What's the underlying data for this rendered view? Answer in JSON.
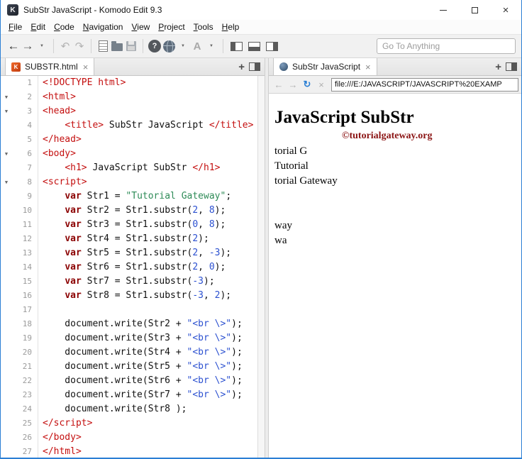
{
  "window": {
    "title": "SubStr JavaScript - Komodo Edit 9.3",
    "app_icon_letter": "K"
  },
  "menu": {
    "items": [
      "File",
      "Edit",
      "Code",
      "Navigation",
      "View",
      "Project",
      "Tools",
      "Help"
    ]
  },
  "toolbar": {
    "goto_placeholder": "Go To Anything",
    "font_button": "A"
  },
  "icons": {
    "back": "←",
    "forward": "→",
    "dropdown": "▼",
    "undo": "↶",
    "redo": "↷",
    "help": "?",
    "close": "×",
    "tab_close": "×",
    "plus": "+",
    "refresh": "↻",
    "stop": "×",
    "fold": "▼",
    "file_letter": "K"
  },
  "tabs": {
    "editor": {
      "label": "SUBSTR.html"
    },
    "preview": {
      "label": "SubStr JavaScript"
    }
  },
  "browser": {
    "url": "file:///E:/JAVASCRIPT/JAVASCRIPT%20EXAMP"
  },
  "code": {
    "lines": [
      {
        "n": 1,
        "t": [
          [
            "tag",
            "<!DOCTYPE html>"
          ]
        ]
      },
      {
        "n": 2,
        "fold": true,
        "t": [
          [
            "tag",
            "<html>"
          ]
        ]
      },
      {
        "n": 3,
        "fold": true,
        "t": [
          [
            "tag",
            "<head>"
          ]
        ]
      },
      {
        "n": 4,
        "t": [
          [
            "pln",
            "    "
          ],
          [
            "tag",
            "<title>"
          ],
          [
            "pln",
            " SubStr JavaScript "
          ],
          [
            "tag",
            "</title>"
          ]
        ]
      },
      {
        "n": 5,
        "t": [
          [
            "tag",
            "</head>"
          ]
        ]
      },
      {
        "n": 6,
        "fold": true,
        "t": [
          [
            "tag",
            "<body>"
          ]
        ]
      },
      {
        "n": 7,
        "t": [
          [
            "pln",
            "    "
          ],
          [
            "tag",
            "<h1>"
          ],
          [
            "pln",
            " JavaScript SubStr "
          ],
          [
            "tag",
            "</h1>"
          ]
        ]
      },
      {
        "n": 8,
        "fold": true,
        "t": [
          [
            "tag",
            "<script>"
          ]
        ]
      },
      {
        "n": 9,
        "t": [
          [
            "pln",
            "    "
          ],
          [
            "kw",
            "var"
          ],
          [
            "pln",
            " Str1 = "
          ],
          [
            "str",
            "\"Tutorial Gateway\""
          ],
          [
            "pln",
            ";"
          ]
        ]
      },
      {
        "n": 10,
        "t": [
          [
            "pln",
            "    "
          ],
          [
            "kw",
            "var"
          ],
          [
            "pln",
            " Str2 = Str1.substr("
          ],
          [
            "num",
            "2"
          ],
          [
            "pln",
            ", "
          ],
          [
            "num",
            "8"
          ],
          [
            "pln",
            ");"
          ]
        ]
      },
      {
        "n": 11,
        "t": [
          [
            "pln",
            "    "
          ],
          [
            "kw",
            "var"
          ],
          [
            "pln",
            " Str3 = Str1.substr("
          ],
          [
            "num",
            "0"
          ],
          [
            "pln",
            ", "
          ],
          [
            "num",
            "8"
          ],
          [
            "pln",
            ");"
          ]
        ]
      },
      {
        "n": 12,
        "t": [
          [
            "pln",
            "    "
          ],
          [
            "kw",
            "var"
          ],
          [
            "pln",
            " Str4 = Str1.substr("
          ],
          [
            "num",
            "2"
          ],
          [
            "pln",
            ");"
          ]
        ]
      },
      {
        "n": 13,
        "t": [
          [
            "pln",
            "    "
          ],
          [
            "kw",
            "var"
          ],
          [
            "pln",
            " Str5 = Str1.substr("
          ],
          [
            "num",
            "2"
          ],
          [
            "pln",
            ", "
          ],
          [
            "num",
            "-3"
          ],
          [
            "pln",
            ");"
          ]
        ]
      },
      {
        "n": 14,
        "t": [
          [
            "pln",
            "    "
          ],
          [
            "kw",
            "var"
          ],
          [
            "pln",
            " Str6 = Str1.substr("
          ],
          [
            "num",
            "2"
          ],
          [
            "pln",
            ", "
          ],
          [
            "num",
            "0"
          ],
          [
            "pln",
            ");"
          ]
        ]
      },
      {
        "n": 15,
        "t": [
          [
            "pln",
            "    "
          ],
          [
            "kw",
            "var"
          ],
          [
            "pln",
            " Str7 = Str1.substr("
          ],
          [
            "num",
            "-3"
          ],
          [
            "pln",
            ");"
          ]
        ]
      },
      {
        "n": 16,
        "t": [
          [
            "pln",
            "    "
          ],
          [
            "kw",
            "var"
          ],
          [
            "pln",
            " Str8 = Str1.substr("
          ],
          [
            "num",
            "-3"
          ],
          [
            "pln",
            ", "
          ],
          [
            "num",
            "2"
          ],
          [
            "pln",
            ");"
          ]
        ]
      },
      {
        "n": 17,
        "t": []
      },
      {
        "n": 18,
        "t": [
          [
            "pln",
            "    document.write(Str2 + "
          ],
          [
            "str2",
            "\"<br \\>\""
          ],
          [
            "pln",
            ");"
          ]
        ]
      },
      {
        "n": 19,
        "t": [
          [
            "pln",
            "    document.write(Str3 + "
          ],
          [
            "str2",
            "\"<br \\>\""
          ],
          [
            "pln",
            ");"
          ]
        ]
      },
      {
        "n": 20,
        "t": [
          [
            "pln",
            "    document.write(Str4 + "
          ],
          [
            "str2",
            "\"<br \\>\""
          ],
          [
            "pln",
            ");"
          ]
        ]
      },
      {
        "n": 21,
        "t": [
          [
            "pln",
            "    document.write(Str5 + "
          ],
          [
            "str2",
            "\"<br \\>\""
          ],
          [
            "pln",
            ");"
          ]
        ]
      },
      {
        "n": 22,
        "t": [
          [
            "pln",
            "    document.write(Str6 + "
          ],
          [
            "str2",
            "\"<br \\>\""
          ],
          [
            "pln",
            ");"
          ]
        ]
      },
      {
        "n": 23,
        "t": [
          [
            "pln",
            "    document.write(Str7 + "
          ],
          [
            "str2",
            "\"<br \\>\""
          ],
          [
            "pln",
            ");"
          ]
        ]
      },
      {
        "n": 24,
        "t": [
          [
            "pln",
            "    document.write(Str8 );"
          ]
        ]
      },
      {
        "n": 25,
        "t": [
          [
            "tag",
            "</script>"
          ]
        ]
      },
      {
        "n": 26,
        "t": [
          [
            "tag",
            "</body>"
          ]
        ]
      },
      {
        "n": 27,
        "t": [
          [
            "tag",
            "</html>"
          ]
        ]
      }
    ]
  },
  "preview": {
    "heading": "JavaScript SubStr",
    "watermark": "©tutorialgateway.org",
    "output": [
      "torial G",
      "Tutorial",
      "torial Gateway",
      "",
      "",
      "way",
      "wa"
    ]
  }
}
